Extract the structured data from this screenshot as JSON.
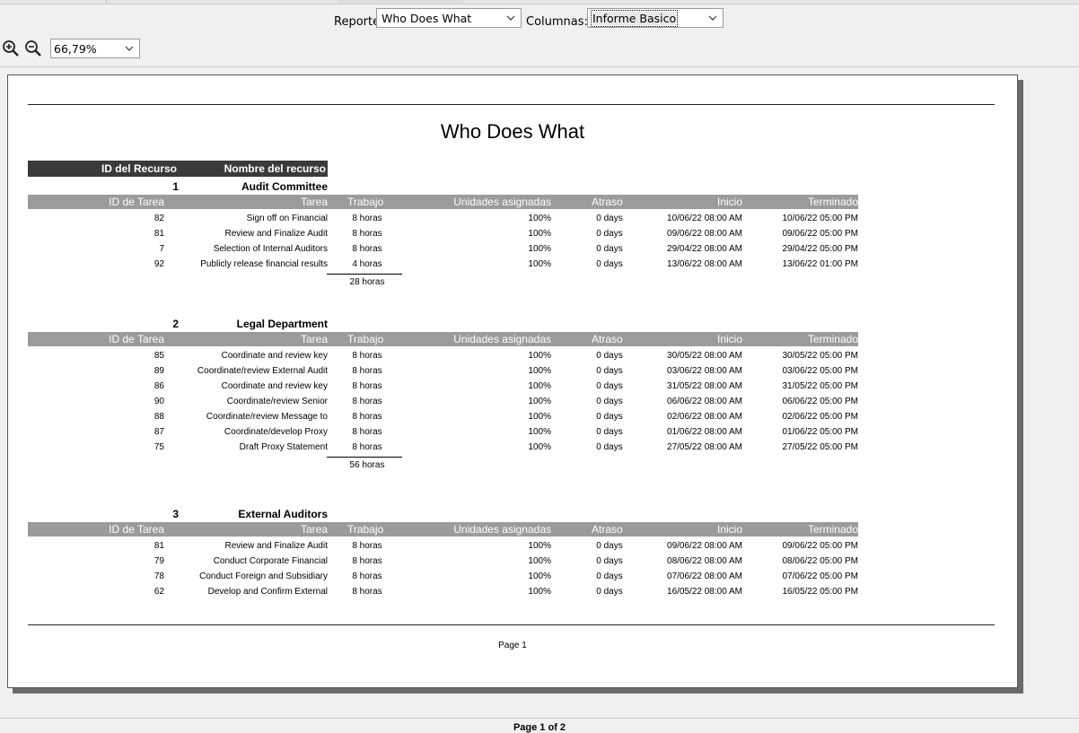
{
  "toolbar": {
    "reporte_label": "Reporte:",
    "reporte_value": "Who Does What",
    "columnas_label": "Columnas:",
    "columnas_value": "Informe Basico",
    "zoom_value": "66,79%"
  },
  "report": {
    "title": "Who Does What",
    "resource_headers": {
      "id": "ID del Recurso",
      "name": "Nombre del recurso"
    },
    "task_headers": {
      "id": "ID de Tarea",
      "task": "Tarea",
      "work": "Trabajo",
      "units": "Unidades asignadas",
      "delay": "Atraso",
      "start": "Inicio",
      "finish": "Terminado"
    },
    "groups": [
      {
        "id": "1",
        "name": "Audit Committee",
        "total": "28 horas",
        "rows": [
          [
            "82",
            "Sign off on Financial",
            "8 horas",
            "100%",
            "0 days",
            "10/06/22 08:00 AM",
            "10/06/22 05:00 PM"
          ],
          [
            "81",
            "Review and Finalize Audit",
            "8 horas",
            "100%",
            "0 days",
            "09/06/22 08:00 AM",
            "09/06/22 05:00 PM"
          ],
          [
            "7",
            "Selection of Internal Auditors",
            "8 horas",
            "100%",
            "0 days",
            "29/04/22 08:00 AM",
            "29/04/22 05:00 PM"
          ],
          [
            "92",
            "Publicly release financial results",
            "4 horas",
            "100%",
            "0 days",
            "13/06/22 08:00 AM",
            "13/06/22 01:00 PM"
          ]
        ]
      },
      {
        "id": "2",
        "name": "Legal Department",
        "total": "56 horas",
        "rows": [
          [
            "85",
            "Coordinate and review key",
            "8 horas",
            "100%",
            "0 days",
            "30/05/22 08:00 AM",
            "30/05/22 05:00 PM"
          ],
          [
            "89",
            "Coordinate/review External Audit",
            "8 horas",
            "100%",
            "0 days",
            "03/06/22 08:00 AM",
            "03/06/22 05:00 PM"
          ],
          [
            "86",
            "Coordinate and review key",
            "8 horas",
            "100%",
            "0 days",
            "31/05/22 08:00 AM",
            "31/05/22 05:00 PM"
          ],
          [
            "90",
            "Coordinate/review Senior",
            "8 horas",
            "100%",
            "0 days",
            "06/06/22 08:00 AM",
            "06/06/22 05:00 PM"
          ],
          [
            "88",
            "Coordinate/review Message to",
            "8 horas",
            "100%",
            "0 days",
            "02/06/22 08:00 AM",
            "02/06/22 05:00 PM"
          ],
          [
            "87",
            "Coordinate/develop Proxy",
            "8 horas",
            "100%",
            "0 days",
            "01/06/22 08:00 AM",
            "01/06/22 05:00 PM"
          ],
          [
            "75",
            "Draft Proxy Statement",
            "8 horas",
            "100%",
            "0 days",
            "27/05/22 08:00 AM",
            "27/05/22 05:00 PM"
          ]
        ]
      },
      {
        "id": "3",
        "name": "External Auditors",
        "total": "",
        "rows": [
          [
            "81",
            "Review and Finalize Audit",
            "8 horas",
            "100%",
            "0 days",
            "09/06/22 08:00 AM",
            "09/06/22 05:00 PM"
          ],
          [
            "79",
            "Conduct Corporate Financial",
            "8 horas",
            "100%",
            "0 days",
            "08/06/22 08:00 AM",
            "08/06/22 05:00 PM"
          ],
          [
            "78",
            "Conduct Foreign and Subsidiary",
            "8 horas",
            "100%",
            "0 days",
            "07/06/22 08:00 AM",
            "07/06/22 05:00 PM"
          ],
          [
            "62",
            "Develop and Confirm External",
            "8 horas",
            "100%",
            "0 days",
            "16/05/22 08:00 AM",
            "16/05/22 05:00 PM"
          ]
        ]
      }
    ],
    "footer": "Page 1"
  },
  "status": {
    "page_indicator": "Page 1 of 2"
  }
}
